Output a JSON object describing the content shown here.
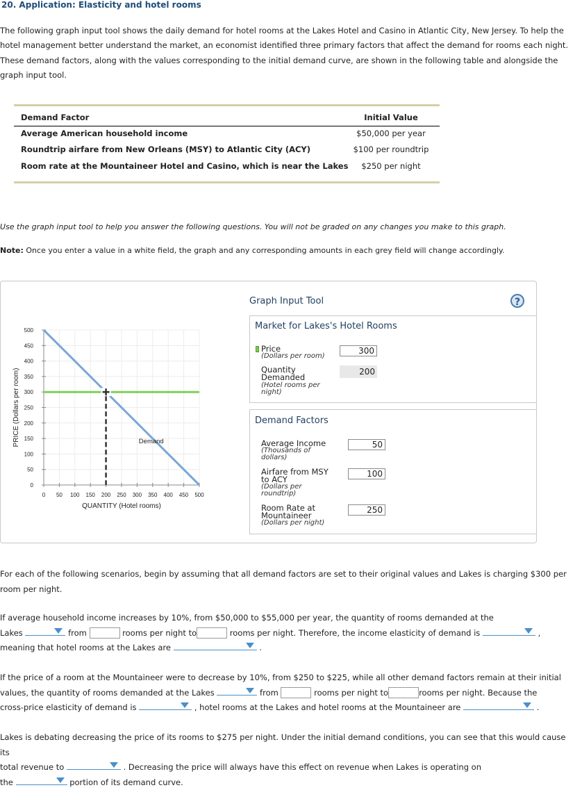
{
  "header": {
    "title": "20. Application: Elasticity and hotel rooms"
  },
  "intro": "The following graph input tool shows the daily demand for hotel rooms at the Lakes Hotel and Casino in Atlantic City, New Jersey. To help the hotel management better understand the market, an economist identified three primary factors that affect the demand for rooms each night. These demand factors, along with the values corresponding to the initial demand curve, are shown in the following table and alongside the graph input tool.",
  "factor_table": {
    "headers": [
      "Demand Factor",
      "Initial Value"
    ],
    "rows": [
      {
        "factor": "Average American household income",
        "value": "$50,000 per year"
      },
      {
        "factor": "Roundtrip airfare from New Orleans (MSY) to Atlantic City (ACY)",
        "value": "$100 per roundtrip"
      },
      {
        "factor": "Room rate at the Mountaineer Hotel and Casino, which is near the Lakes",
        "value": "$250 per night"
      }
    ]
  },
  "notes": {
    "use_tool": "Use the graph input tool to help you answer the following questions. You will not be graded on any changes you make to this graph.",
    "note_label": "Note:",
    "note_text": " Once you enter a value in a white field, the graph and any corresponding amounts in each grey field will change accordingly."
  },
  "tool": {
    "title": "Graph Input Tool",
    "help_icon": "?",
    "market_panel": {
      "title": "Market for Lakes's Hotel Rooms",
      "price_label": "Price",
      "price_unit": "(Dollars per room)",
      "price_value": "300",
      "qty_label_1": "Quantity",
      "qty_label_2": "Demanded",
      "qty_unit_1": "(Hotel rooms per",
      "qty_unit_2": "night)",
      "qty_value": "200"
    },
    "factors_panel": {
      "title": "Demand Factors",
      "income_label": "Average Income",
      "income_unit_1": "(Thousands of",
      "income_unit_2": "dollars)",
      "income_value": "50",
      "airfare_label_1": "Airfare from MSY",
      "airfare_label_2": "to ACY",
      "airfare_unit_1": "(Dollars per",
      "airfare_unit_2": "roundtrip)",
      "airfare_value": "100",
      "room_label_1": "Room Rate at",
      "room_label_2": "Mountaineer",
      "room_unit": "(Dollars per night)",
      "room_value": "250"
    }
  },
  "chart_data": {
    "type": "line",
    "title": "",
    "xlabel": "QUANTITY (Hotel rooms)",
    "ylabel": "PRICE (Dollars per room)",
    "xlim": [
      0,
      500
    ],
    "ylim": [
      0,
      500
    ],
    "xticks": [
      0,
      50,
      100,
      150,
      200,
      250,
      300,
      350,
      400,
      450,
      500
    ],
    "yticks": [
      0,
      50,
      100,
      150,
      200,
      250,
      300,
      350,
      400,
      450,
      500
    ],
    "grid": true,
    "series": [
      {
        "name": "Demand",
        "color": "#7ba7d4",
        "points": [
          [
            0,
            500
          ],
          [
            500,
            0
          ]
        ]
      }
    ],
    "price_line": {
      "value": 300,
      "color": "#7ed05a"
    },
    "marker": {
      "x": 200,
      "y": 300
    },
    "dashed_drop": {
      "x": 200,
      "from": 300,
      "to": 0,
      "color": "#333333"
    },
    "annotations": [
      {
        "text": "Demand",
        "x": 350,
        "y": 135
      }
    ]
  },
  "scenarios_intro": "For each of the following scenarios, begin by assuming that all demand factors are set to their original values and Lakes is charging $300 per room per night.",
  "q1": {
    "line1": "If average household income increases by 10%, from $50,000 to $55,000 per year, the quantity of rooms demanded at the",
    "t1": "Lakes",
    "t2": "from",
    "t3": "rooms per night to",
    "t4": "rooms per night. Therefore, the income elasticity of demand is",
    "t5": ",",
    "t6": "meaning that hotel rooms at the Lakes are",
    "t7": "."
  },
  "q2": {
    "line1": "If the price of a room at the Mountaineer were to decrease by 10%, from $250 to $225, while all other demand factors remain at their initial",
    "t1": "values, the quantity of rooms demanded at the Lakes",
    "t2": "from",
    "t3": "rooms per night to",
    "t4": "rooms per night. Because the",
    "t5": "cross-price elasticity of demand is",
    "t6": ", hotel rooms at the Lakes and hotel rooms at the Mountaineer are",
    "t7": "."
  },
  "q3": {
    "line1": "Lakes is debating decreasing the price of its rooms to $275 per night. Under the initial demand conditions, you can see that this would cause its",
    "t1": "total revenue to",
    "t2": ". Decreasing the price will always have this effect on revenue when Lakes is operating on",
    "t3": "the",
    "t4": "portion of its demand curve."
  }
}
